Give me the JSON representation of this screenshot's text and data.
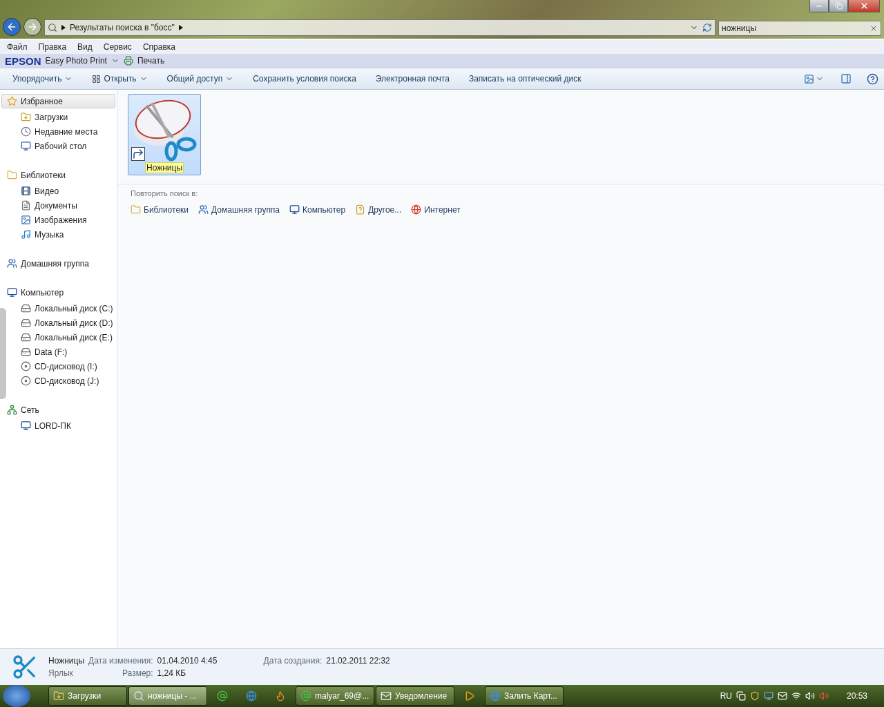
{
  "address": {
    "path": "Результаты поиска в \"босс\""
  },
  "search": {
    "value": "ножницы"
  },
  "menu": [
    "Файл",
    "Правка",
    "Вид",
    "Сервис",
    "Справка"
  ],
  "epson": {
    "brand": "EPSON",
    "app": "Easy Photo Print",
    "print": "Печать"
  },
  "commands": [
    {
      "label": "Упорядочить",
      "dropdown": true,
      "icon": false
    },
    {
      "label": "Открыть",
      "dropdown": true,
      "icon": true
    },
    {
      "label": "Общий доступ",
      "dropdown": true,
      "icon": false
    },
    {
      "label": "Сохранить условия поиска",
      "dropdown": false,
      "icon": false
    },
    {
      "label": "Электронная почта",
      "dropdown": false,
      "icon": false
    },
    {
      "label": "Записать на оптический диск",
      "dropdown": false,
      "icon": false
    }
  ],
  "sidebar": {
    "sections": [
      {
        "label": "Избранное",
        "kind": "star",
        "selected": true,
        "children": [
          {
            "label": "Загрузки",
            "kind": "downloads"
          },
          {
            "label": "Недавние места",
            "kind": "recent"
          },
          {
            "label": "Рабочий стол",
            "kind": "desktop"
          }
        ]
      },
      {
        "label": "Библиотеки",
        "kind": "library",
        "selected": false,
        "children": [
          {
            "label": "Видео",
            "kind": "video"
          },
          {
            "label": "Документы",
            "kind": "document"
          },
          {
            "label": "Изображения",
            "kind": "image"
          },
          {
            "label": "Музыка",
            "kind": "music"
          }
        ]
      },
      {
        "label": "Домашняя группа",
        "kind": "homegroup",
        "selected": false
      },
      {
        "label": "Компьютер",
        "kind": "computer",
        "selected": false,
        "children": [
          {
            "label": "Локальный диск (C:)",
            "kind": "drive"
          },
          {
            "label": "Локальный диск (D:)",
            "kind": "drive"
          },
          {
            "label": "Локальный диск (E:)",
            "kind": "drive"
          },
          {
            "label": "Data (F:)",
            "kind": "drive"
          },
          {
            "label": "CD-дисковод (I:)",
            "kind": "cd"
          },
          {
            "label": "CD-дисковод (J:)",
            "kind": "cd"
          }
        ]
      },
      {
        "label": "Сеть",
        "kind": "network",
        "selected": false,
        "children": [
          {
            "label": "LORD-ПК",
            "kind": "computer"
          }
        ]
      }
    ]
  },
  "files": [
    {
      "name": "Ножницы",
      "selected": true
    }
  ],
  "repeat": {
    "title": "Повторить поиск в:",
    "links": [
      {
        "label": "Библиотеки",
        "kind": "library"
      },
      {
        "label": "Домашняя группа",
        "kind": "homegroup"
      },
      {
        "label": "Компьютер",
        "kind": "computer"
      },
      {
        "label": "Другое...",
        "kind": "other"
      },
      {
        "label": "Интернет",
        "kind": "internet"
      }
    ]
  },
  "details": {
    "name": "Ножницы",
    "type": "Ярлык",
    "fields": [
      {
        "label": "Дата изменения:",
        "value": "01.04.2010 4:45"
      },
      {
        "label": "Размер:",
        "value": "1,24 КБ"
      },
      {
        "label": "Дата создания:",
        "value": "21.02.2011 22:32"
      }
    ]
  },
  "taskbar": {
    "items": [
      {
        "kind": "task",
        "label": "Загрузки",
        "selected": false
      },
      {
        "kind": "task",
        "label": "ножницы - ...",
        "selected": true
      },
      {
        "kind": "launcher"
      },
      {
        "kind": "launcher"
      },
      {
        "kind": "launcher"
      },
      {
        "kind": "task",
        "label": "malyar_69@...",
        "selected": false
      },
      {
        "kind": "task",
        "label": "Уведомление",
        "selected": false
      },
      {
        "kind": "launcher"
      },
      {
        "kind": "task",
        "label": "Залить Карт...",
        "selected": false
      }
    ],
    "language": "RU",
    "time": "20:53"
  }
}
